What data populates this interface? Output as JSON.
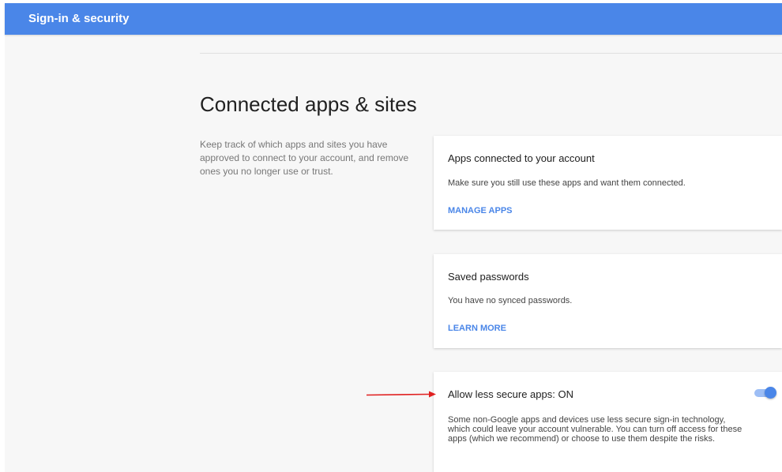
{
  "header": {
    "title": "Sign-in & security"
  },
  "section": {
    "title": "Connected apps & sites",
    "description": "Keep track of which apps and sites you have approved to connect to your account, and remove ones you no longer use or trust."
  },
  "cards": {
    "apps": {
      "title": "Apps connected to your account",
      "text": "Make sure you still use these apps and want them connected.",
      "link": "MANAGE APPS"
    },
    "passwords": {
      "title": "Saved passwords",
      "text": "You have no synced passwords.",
      "link": "LEARN MORE"
    },
    "less_secure": {
      "title": "Allow less secure apps: ON",
      "text": "Some non-Google apps and devices use less secure sign-in technology, which could leave your account vulnerable. You can turn off access for these apps (which we recommend) or choose to use them despite the risks.",
      "toggle_state": "on"
    }
  },
  "colors": {
    "accent": "#4a86e8",
    "annotation_arrow": "#e02020"
  }
}
